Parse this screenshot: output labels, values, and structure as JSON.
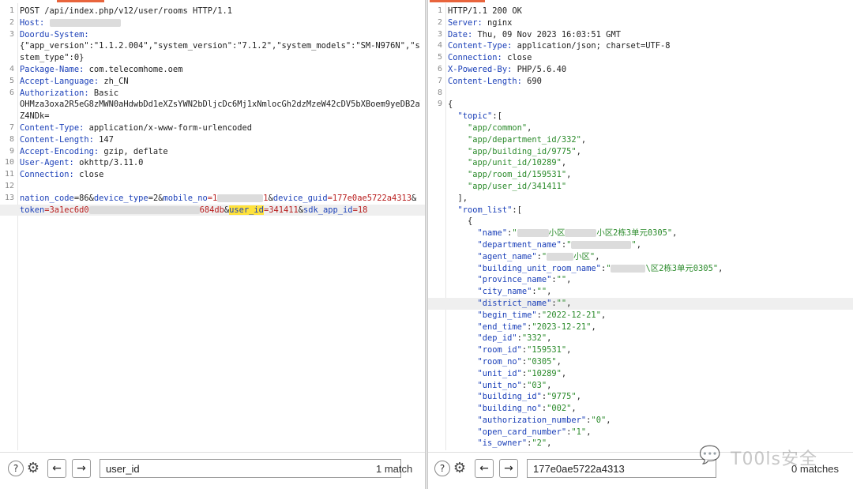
{
  "request": {
    "active_tab_indicator_color": "#e8643c",
    "lines": [
      {
        "n": "1",
        "parts": [
          {
            "t": "POST /api/index.php/v12/user/rooms HTTP/1.1"
          }
        ]
      },
      {
        "n": "2",
        "parts": [
          {
            "t": "Host: ",
            "c": "k"
          },
          {
            "mask": 90
          }
        ]
      },
      {
        "n": "3",
        "parts": [
          {
            "t": "Doordu-System:",
            "c": "k"
          }
        ]
      },
      {
        "n": "",
        "parts": [
          {
            "t": "{\"app_version\":\"1.1.2.004\",\"system_version\":\"7.1.2\",\"system_models\":\"SM-N976N\",\"sy"
          }
        ]
      },
      {
        "n": "",
        "parts": [
          {
            "t": "stem_type\":0}"
          }
        ]
      },
      {
        "n": "4",
        "parts": [
          {
            "t": "Package-Name:",
            "c": "k"
          },
          {
            "t": " com.telecomhome.oem"
          }
        ]
      },
      {
        "n": "5",
        "parts": [
          {
            "t": "Accept-Language:",
            "c": "k"
          },
          {
            "t": " zh_CN"
          }
        ]
      },
      {
        "n": "6",
        "parts": [
          {
            "t": "Authorization:",
            "c": "k"
          },
          {
            "t": " Basic"
          }
        ]
      },
      {
        "n": "",
        "parts": [
          {
            "t": "OHMza3oxa2R5eG8zMWN0aHdwbDd1eXZsYWN2bDljcDc6Mj1xNmlocGh2dzMzeW42cDV5bXBoem9yeDB2aW"
          }
        ]
      },
      {
        "n": "",
        "parts": [
          {
            "t": "Z4NDk="
          }
        ]
      },
      {
        "n": "7",
        "parts": [
          {
            "t": "Content-Type:",
            "c": "k"
          },
          {
            "t": " application/x-www-form-urlencoded"
          }
        ]
      },
      {
        "n": "8",
        "parts": [
          {
            "t": "Content-Length:",
            "c": "k"
          },
          {
            "t": " 147"
          }
        ]
      },
      {
        "n": "9",
        "parts": [
          {
            "t": "Accept-Encoding:",
            "c": "k"
          },
          {
            "t": " gzip, deflate"
          }
        ]
      },
      {
        "n": "10",
        "parts": [
          {
            "t": "User-Agent:",
            "c": "k"
          },
          {
            "t": " okhttp/3.11.0"
          }
        ]
      },
      {
        "n": "11",
        "parts": [
          {
            "t": "Connection:",
            "c": "k"
          },
          {
            "t": " close"
          }
        ]
      },
      {
        "n": "12",
        "parts": []
      },
      {
        "n": "13",
        "parts": [
          {
            "t": "nation_code",
            "c": "k"
          },
          {
            "t": "=86&"
          },
          {
            "t": "device_type",
            "c": "k"
          },
          {
            "t": "=2&"
          },
          {
            "t": "mobile_no",
            "c": "k"
          },
          {
            "t": "=1",
            "c": "p"
          },
          {
            "mask": 58
          },
          {
            "t": "1",
            "c": "p"
          },
          {
            "t": "&"
          },
          {
            "t": "device_guid",
            "c": "k"
          },
          {
            "t": "=177e0ae5722a4313",
            "c": "p"
          },
          {
            "t": "&"
          }
        ]
      },
      {
        "n": "",
        "hl": true,
        "parts": [
          {
            "t": "token",
            "c": "k"
          },
          {
            "t": "=3a1ec6d0",
            "c": "p"
          },
          {
            "mask": 140
          },
          {
            "t": "684db",
            "c": "p"
          },
          {
            "t": "&"
          },
          {
            "t": "user_id",
            "c": "k",
            "mark": true
          },
          {
            "t": "=341411",
            "c": "p"
          },
          {
            "t": "&"
          },
          {
            "t": "sdk_app_id",
            "c": "k"
          },
          {
            "t": "=18",
            "c": "p"
          }
        ]
      }
    ],
    "find": {
      "help_icon": "?",
      "query": "user_id",
      "result": "1 match"
    }
  },
  "response": {
    "lines": [
      {
        "n": "1",
        "parts": [
          {
            "t": "HTTP/1.1 200 OK"
          }
        ]
      },
      {
        "n": "2",
        "parts": [
          {
            "t": "Server:",
            "c": "k"
          },
          {
            "t": " nginx"
          }
        ]
      },
      {
        "n": "3",
        "parts": [
          {
            "t": "Date:",
            "c": "k"
          },
          {
            "t": " Thu, 09 Nov 2023 16:03:51 GMT"
          }
        ]
      },
      {
        "n": "4",
        "parts": [
          {
            "t": "Content-Type:",
            "c": "k"
          },
          {
            "t": " application/json; charset=UTF-8"
          }
        ]
      },
      {
        "n": "5",
        "parts": [
          {
            "t": "Connection:",
            "c": "k"
          },
          {
            "t": " close"
          }
        ]
      },
      {
        "n": "6",
        "parts": [
          {
            "t": "X-Powered-By:",
            "c": "k"
          },
          {
            "t": " PHP/5.6.40"
          }
        ]
      },
      {
        "n": "7",
        "parts": [
          {
            "t": "Content-Length:",
            "c": "k"
          },
          {
            "t": " 690"
          }
        ]
      },
      {
        "n": "8",
        "parts": []
      },
      {
        "n": "9",
        "parts": [
          {
            "t": "{"
          }
        ]
      },
      {
        "n": "",
        "parts": [
          {
            "t": "  \"topic\"",
            "c": "k"
          },
          {
            "t": ":["
          }
        ]
      },
      {
        "n": "",
        "parts": [
          {
            "t": "    \"app/common\"",
            "c": "s"
          },
          {
            "t": ","
          }
        ]
      },
      {
        "n": "",
        "parts": [
          {
            "t": "    \"app/department_id/332\"",
            "c": "s"
          },
          {
            "t": ","
          }
        ]
      },
      {
        "n": "",
        "parts": [
          {
            "t": "    \"app/building_id/9775\"",
            "c": "s"
          },
          {
            "t": ","
          }
        ]
      },
      {
        "n": "",
        "parts": [
          {
            "t": "    \"app/unit_id/10289\"",
            "c": "s"
          },
          {
            "t": ","
          }
        ]
      },
      {
        "n": "",
        "parts": [
          {
            "t": "    \"app/room_id/159531\"",
            "c": "s"
          },
          {
            "t": ","
          }
        ]
      },
      {
        "n": "",
        "parts": [
          {
            "t": "    \"app/user_id/341411\"",
            "c": "s"
          }
        ]
      },
      {
        "n": "",
        "parts": [
          {
            "t": "  ],"
          }
        ]
      },
      {
        "n": "",
        "parts": [
          {
            "t": "  \"room_list\"",
            "c": "k"
          },
          {
            "t": ":["
          }
        ]
      },
      {
        "n": "",
        "parts": [
          {
            "t": "    {"
          }
        ]
      },
      {
        "n": "",
        "parts": [
          {
            "t": "      \"name\"",
            "c": "k"
          },
          {
            "t": ":"
          },
          {
            "t": "\"",
            "c": "s"
          },
          {
            "mask": 40
          },
          {
            "t": "小区",
            "c": "s"
          },
          {
            "mask": 40
          },
          {
            "t": "小区2栋3单元0305\"",
            "c": "s"
          },
          {
            "t": ","
          }
        ]
      },
      {
        "n": "",
        "parts": [
          {
            "t": "      \"department_name\"",
            "c": "k"
          },
          {
            "t": ":"
          },
          {
            "t": "\"",
            "c": "s"
          },
          {
            "mask": 76
          },
          {
            "t": "\"",
            "c": "s"
          },
          {
            "t": ","
          }
        ]
      },
      {
        "n": "",
        "parts": [
          {
            "t": "      \"agent_name\"",
            "c": "k"
          },
          {
            "t": ":"
          },
          {
            "t": "\"",
            "c": "s"
          },
          {
            "mask": 34
          },
          {
            "t": "小区\"",
            "c": "s"
          },
          {
            "t": ","
          }
        ]
      },
      {
        "n": "",
        "parts": [
          {
            "t": "      \"building_unit_room_name\"",
            "c": "k"
          },
          {
            "t": ":"
          },
          {
            "t": "\"",
            "c": "s"
          },
          {
            "mask": 44
          },
          {
            "t": "\\区2栋3单元0305\"",
            "c": "s"
          },
          {
            "t": ","
          }
        ]
      },
      {
        "n": "",
        "parts": [
          {
            "t": "      \"province_name\"",
            "c": "k"
          },
          {
            "t": ":"
          },
          {
            "t": "\"\"",
            "c": "s"
          },
          {
            "t": ","
          }
        ]
      },
      {
        "n": "",
        "parts": [
          {
            "t": "      \"city_name\"",
            "c": "k"
          },
          {
            "t": ":"
          },
          {
            "t": "\"\"",
            "c": "s"
          },
          {
            "t": ","
          }
        ]
      },
      {
        "n": "",
        "hl": true,
        "parts": [
          {
            "t": "      \"district_name\"",
            "c": "k"
          },
          {
            "t": ":"
          },
          {
            "t": "\"\"",
            "c": "s"
          },
          {
            "t": ","
          }
        ]
      },
      {
        "n": "",
        "parts": [
          {
            "t": "      \"begin_time\"",
            "c": "k"
          },
          {
            "t": ":"
          },
          {
            "t": "\"2022-12-21\"",
            "c": "s"
          },
          {
            "t": ","
          }
        ]
      },
      {
        "n": "",
        "parts": [
          {
            "t": "      \"end_time\"",
            "c": "k"
          },
          {
            "t": ":"
          },
          {
            "t": "\"2023-12-21\"",
            "c": "s"
          },
          {
            "t": ","
          }
        ]
      },
      {
        "n": "",
        "parts": [
          {
            "t": "      \"dep_id\"",
            "c": "k"
          },
          {
            "t": ":"
          },
          {
            "t": "\"332\"",
            "c": "s"
          },
          {
            "t": ","
          }
        ]
      },
      {
        "n": "",
        "parts": [
          {
            "t": "      \"room_id\"",
            "c": "k"
          },
          {
            "t": ":"
          },
          {
            "t": "\"159531\"",
            "c": "s"
          },
          {
            "t": ","
          }
        ]
      },
      {
        "n": "",
        "parts": [
          {
            "t": "      \"room_no\"",
            "c": "k"
          },
          {
            "t": ":"
          },
          {
            "t": "\"0305\"",
            "c": "s"
          },
          {
            "t": ","
          }
        ]
      },
      {
        "n": "",
        "parts": [
          {
            "t": "      \"unit_id\"",
            "c": "k"
          },
          {
            "t": ":"
          },
          {
            "t": "\"10289\"",
            "c": "s"
          },
          {
            "t": ","
          }
        ]
      },
      {
        "n": "",
        "parts": [
          {
            "t": "      \"unit_no\"",
            "c": "k"
          },
          {
            "t": ":"
          },
          {
            "t": "\"03\"",
            "c": "s"
          },
          {
            "t": ","
          }
        ]
      },
      {
        "n": "",
        "parts": [
          {
            "t": "      \"building_id\"",
            "c": "k"
          },
          {
            "t": ":"
          },
          {
            "t": "\"9775\"",
            "c": "s"
          },
          {
            "t": ","
          }
        ]
      },
      {
        "n": "",
        "parts": [
          {
            "t": "      \"building_no\"",
            "c": "k"
          },
          {
            "t": ":"
          },
          {
            "t": "\"002\"",
            "c": "s"
          },
          {
            "t": ","
          }
        ]
      },
      {
        "n": "",
        "parts": [
          {
            "t": "      \"authorization_number\"",
            "c": "k"
          },
          {
            "t": ":"
          },
          {
            "t": "\"0\"",
            "c": "s"
          },
          {
            "t": ","
          }
        ]
      },
      {
        "n": "",
        "parts": [
          {
            "t": "      \"open_card_number\"",
            "c": "k"
          },
          {
            "t": ":"
          },
          {
            "t": "\"1\"",
            "c": "s"
          },
          {
            "t": ","
          }
        ]
      },
      {
        "n": "",
        "parts": [
          {
            "t": "      \"is_owner\"",
            "c": "k"
          },
          {
            "t": ":"
          },
          {
            "t": "\"2\"",
            "c": "s"
          },
          {
            "t": ","
          }
        ]
      }
    ],
    "find": {
      "help_icon": "?",
      "query": "177e0ae5722a4313",
      "result": "0 matches"
    }
  },
  "watermark": {
    "text": "T00ls安全",
    "icon": "wechat-logo"
  },
  "colors": {
    "key": "#1a3fb8",
    "string": "#2a8a2a",
    "param_value": "#b81c1c",
    "match_highlight": "#ffe23c",
    "line_highlight": "#efefef"
  }
}
